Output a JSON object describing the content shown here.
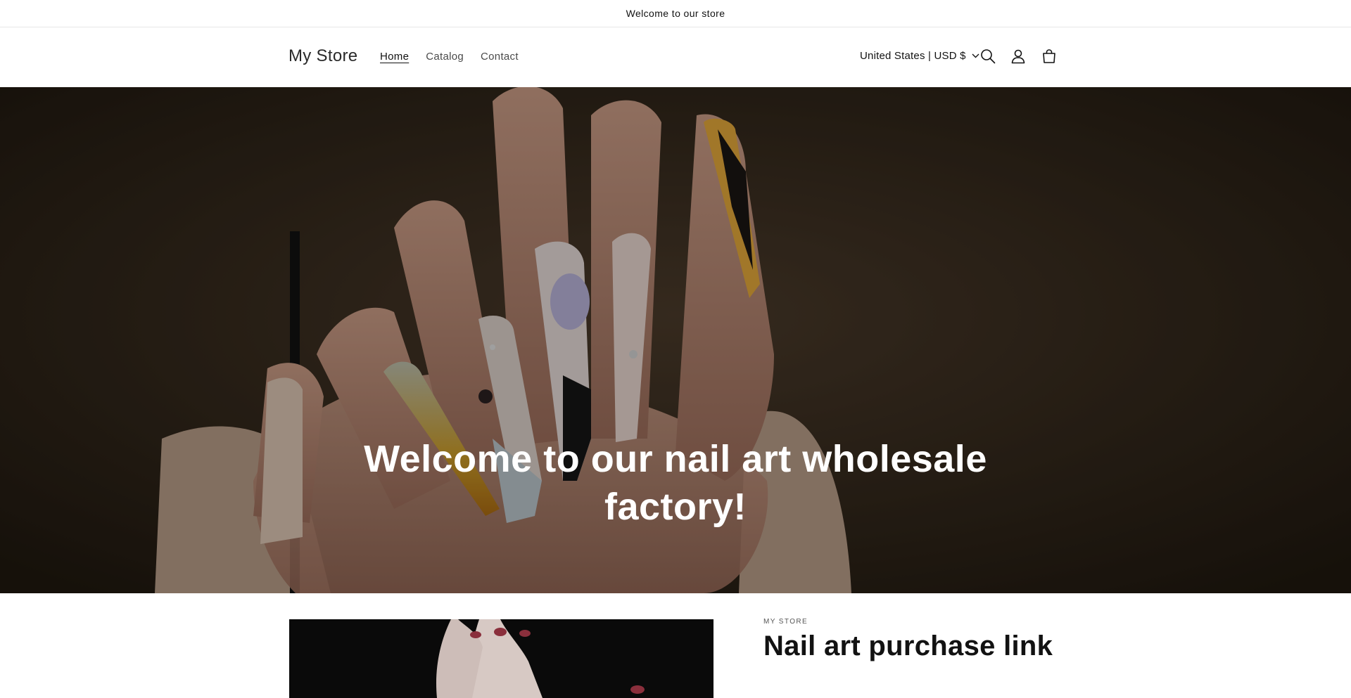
{
  "announcement": {
    "text": "Welcome to our store"
  },
  "header": {
    "logo": "My Store",
    "nav": [
      {
        "label": "Home",
        "active": true
      },
      {
        "label": "Catalog",
        "active": false
      },
      {
        "label": "Contact",
        "active": false
      }
    ],
    "country_selector": "United States | USD $",
    "icons": [
      "search-icon",
      "account-icon",
      "cart-icon"
    ]
  },
  "hero": {
    "title": "Welcome to our nail art wholesale factory!"
  },
  "feature": {
    "subheading": "MY STORE",
    "title": "Nail art purchase link"
  },
  "colors": {
    "hero_bg": "#2a2117",
    "text": "#121212",
    "border": "#e6e6e6"
  }
}
